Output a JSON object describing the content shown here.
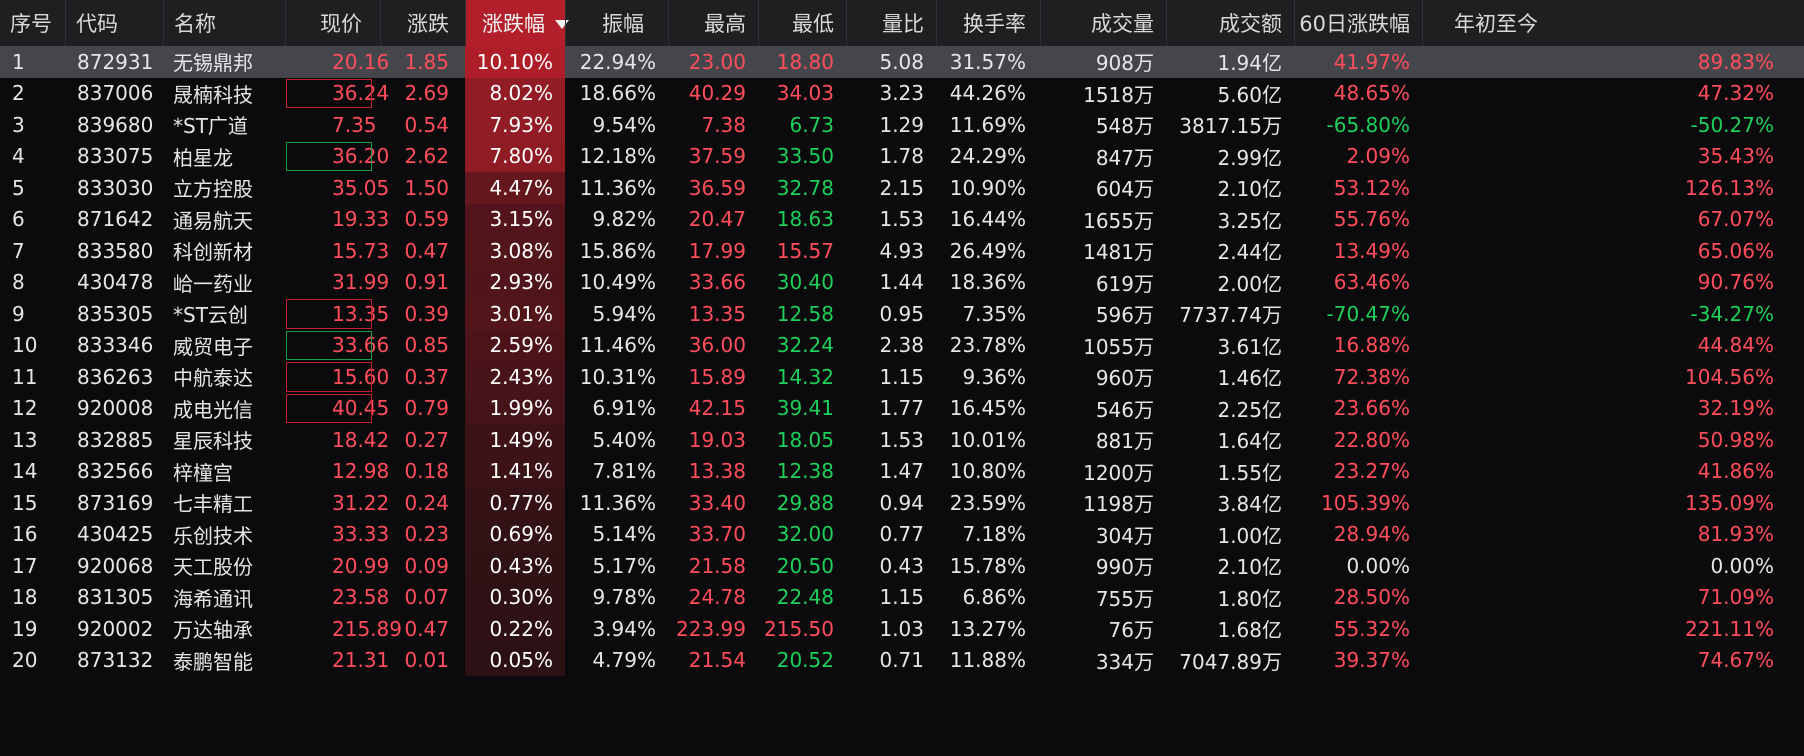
{
  "table": {
    "header": [
      "序号",
      "代码",
      "名称",
      "现价",
      "涨跌",
      "涨跌幅",
      "振幅",
      "最高",
      "最低",
      "量比",
      "换手率",
      "成交量",
      "成交额",
      "60日涨跌幅",
      "年初至今"
    ],
    "sort": {
      "column": "涨跌幅",
      "direction": "desc"
    },
    "rows": [
      {
        "idx": "1",
        "code": "872931",
        "name": "无锡鼎邦",
        "price": "20.16",
        "change": "1.85",
        "change_pct": "10.10%",
        "amplitude": "22.94%",
        "high": "23.00",
        "low": "18.80",
        "volume_ratio": "5.08",
        "turnover": "31.57%",
        "volume": "908万",
        "amount": "1.94亿",
        "change_60d": "41.97%",
        "ytd": "89.83%"
      },
      {
        "idx": "2",
        "code": "837006",
        "name": "晟楠科技",
        "price": "36.24",
        "change": "2.69",
        "change_pct": "8.02%",
        "amplitude": "18.66%",
        "high": "40.29",
        "low": "34.03",
        "volume_ratio": "3.23",
        "turnover": "44.26%",
        "volume": "1518万",
        "amount": "5.60亿",
        "change_60d": "48.65%",
        "ytd": "47.32%"
      },
      {
        "idx": "3",
        "code": "839680",
        "name": "*ST广道",
        "price": "7.35",
        "change": "0.54",
        "change_pct": "7.93%",
        "amplitude": "9.54%",
        "high": "7.38",
        "low": "6.73",
        "volume_ratio": "1.29",
        "turnover": "11.69%",
        "volume": "548万",
        "amount": "3817.15万",
        "change_60d": "-65.80%",
        "ytd": "-50.27%"
      },
      {
        "idx": "4",
        "code": "833075",
        "name": "柏星龙",
        "price": "36.20",
        "change": "2.62",
        "change_pct": "7.80%",
        "amplitude": "12.18%",
        "high": "37.59",
        "low": "33.50",
        "volume_ratio": "1.78",
        "turnover": "24.29%",
        "volume": "847万",
        "amount": "2.99亿",
        "change_60d": "2.09%",
        "ytd": "35.43%"
      },
      {
        "idx": "5",
        "code": "833030",
        "name": "立方控股",
        "price": "35.05",
        "change": "1.50",
        "change_pct": "4.47%",
        "amplitude": "11.36%",
        "high": "36.59",
        "low": "32.78",
        "volume_ratio": "2.15",
        "turnover": "10.90%",
        "volume": "604万",
        "amount": "2.10亿",
        "change_60d": "53.12%",
        "ytd": "126.13%"
      },
      {
        "idx": "6",
        "code": "871642",
        "name": "通易航天",
        "price": "19.33",
        "change": "0.59",
        "change_pct": "3.15%",
        "amplitude": "9.82%",
        "high": "20.47",
        "low": "18.63",
        "volume_ratio": "1.53",
        "turnover": "16.44%",
        "volume": "1655万",
        "amount": "3.25亿",
        "change_60d": "55.76%",
        "ytd": "67.07%"
      },
      {
        "idx": "7",
        "code": "833580",
        "name": "科创新材",
        "price": "15.73",
        "change": "0.47",
        "change_pct": "3.08%",
        "amplitude": "15.86%",
        "high": "17.99",
        "low": "15.57",
        "volume_ratio": "4.93",
        "turnover": "26.49%",
        "volume": "1481万",
        "amount": "2.44亿",
        "change_60d": "13.49%",
        "ytd": "65.06%"
      },
      {
        "idx": "8",
        "code": "430478",
        "name": "峆一药业",
        "price": "31.99",
        "change": "0.91",
        "change_pct": "2.93%",
        "amplitude": "10.49%",
        "high": "33.66",
        "low": "30.40",
        "volume_ratio": "1.44",
        "turnover": "18.36%",
        "volume": "619万",
        "amount": "2.00亿",
        "change_60d": "63.46%",
        "ytd": "90.76%"
      },
      {
        "idx": "9",
        "code": "835305",
        "name": "*ST云创",
        "price": "13.35",
        "change": "0.39",
        "change_pct": "3.01%",
        "amplitude": "5.94%",
        "high": "13.35",
        "low": "12.58",
        "volume_ratio": "0.95",
        "turnover": "7.35%",
        "volume": "596万",
        "amount": "7737.74万",
        "change_60d": "-70.47%",
        "ytd": "-34.27%"
      },
      {
        "idx": "10",
        "code": "833346",
        "name": "威贸电子",
        "price": "33.66",
        "change": "0.85",
        "change_pct": "2.59%",
        "amplitude": "11.46%",
        "high": "36.00",
        "low": "32.24",
        "volume_ratio": "2.38",
        "turnover": "23.78%",
        "volume": "1055万",
        "amount": "3.61亿",
        "change_60d": "16.88%",
        "ytd": "44.84%"
      },
      {
        "idx": "11",
        "code": "836263",
        "name": "中航泰达",
        "price": "15.60",
        "change": "0.37",
        "change_pct": "2.43%",
        "amplitude": "10.31%",
        "high": "15.89",
        "low": "14.32",
        "volume_ratio": "1.15",
        "turnover": "9.36%",
        "volume": "960万",
        "amount": "1.46亿",
        "change_60d": "72.38%",
        "ytd": "104.56%"
      },
      {
        "idx": "12",
        "code": "920008",
        "name": "成电光信",
        "price": "40.45",
        "change": "0.79",
        "change_pct": "1.99%",
        "amplitude": "6.91%",
        "high": "42.15",
        "low": "39.41",
        "volume_ratio": "1.77",
        "turnover": "16.45%",
        "volume": "546万",
        "amount": "2.25亿",
        "change_60d": "23.66%",
        "ytd": "32.19%"
      },
      {
        "idx": "13",
        "code": "832885",
        "name": "星辰科技",
        "price": "18.42",
        "change": "0.27",
        "change_pct": "1.49%",
        "amplitude": "5.40%",
        "high": "19.03",
        "low": "18.05",
        "volume_ratio": "1.53",
        "turnover": "10.01%",
        "volume": "881万",
        "amount": "1.64亿",
        "change_60d": "22.80%",
        "ytd": "50.98%"
      },
      {
        "idx": "14",
        "code": "832566",
        "name": "梓橦宫",
        "price": "12.98",
        "change": "0.18",
        "change_pct": "1.41%",
        "amplitude": "7.81%",
        "high": "13.38",
        "low": "12.38",
        "volume_ratio": "1.47",
        "turnover": "10.80%",
        "volume": "1200万",
        "amount": "1.55亿",
        "change_60d": "23.27%",
        "ytd": "41.86%"
      },
      {
        "idx": "15",
        "code": "873169",
        "name": "七丰精工",
        "price": "31.22",
        "change": "0.24",
        "change_pct": "0.77%",
        "amplitude": "11.36%",
        "high": "33.40",
        "low": "29.88",
        "volume_ratio": "0.94",
        "turnover": "23.59%",
        "volume": "1198万",
        "amount": "3.84亿",
        "change_60d": "105.39%",
        "ytd": "135.09%"
      },
      {
        "idx": "16",
        "code": "430425",
        "name": "乐创技术",
        "price": "33.33",
        "change": "0.23",
        "change_pct": "0.69%",
        "amplitude": "5.14%",
        "high": "33.70",
        "low": "32.00",
        "volume_ratio": "0.77",
        "turnover": "7.18%",
        "volume": "304万",
        "amount": "1.00亿",
        "change_60d": "28.94%",
        "ytd": "81.93%"
      },
      {
        "idx": "17",
        "code": "920068",
        "name": "天工股份",
        "price": "20.99",
        "change": "0.09",
        "change_pct": "0.43%",
        "amplitude": "5.17%",
        "high": "21.58",
        "low": "20.50",
        "volume_ratio": "0.43",
        "turnover": "15.78%",
        "volume": "990万",
        "amount": "2.10亿",
        "change_60d": "0.00%",
        "ytd": "0.00%"
      },
      {
        "idx": "18",
        "code": "831305",
        "name": "海希通讯",
        "price": "23.58",
        "change": "0.07",
        "change_pct": "0.30%",
        "amplitude": "9.78%",
        "high": "24.78",
        "low": "22.48",
        "volume_ratio": "1.15",
        "turnover": "6.86%",
        "volume": "755万",
        "amount": "1.80亿",
        "change_60d": "28.50%",
        "ytd": "71.09%"
      },
      {
        "idx": "19",
        "code": "920002",
        "name": "万达轴承",
        "price": "215.89",
        "change": "0.47",
        "change_pct": "0.22%",
        "amplitude": "3.94%",
        "high": "223.99",
        "low": "215.50",
        "volume_ratio": "1.03",
        "turnover": "13.27%",
        "volume": "76万",
        "amount": "1.68亿",
        "change_60d": "55.32%",
        "ytd": "221.11%"
      },
      {
        "idx": "20",
        "code": "873132",
        "name": "泰鹏智能",
        "price": "21.31",
        "change": "0.01",
        "change_pct": "0.05%",
        "amplitude": "4.79%",
        "high": "21.54",
        "low": "20.52",
        "volume_ratio": "0.71",
        "turnover": "11.88%",
        "volume": "334万",
        "amount": "7047.89万",
        "change_60d": "39.37%",
        "ytd": "74.67%"
      }
    ]
  },
  "colors": {
    "up": "#ff4d5b",
    "down": "#1ecf5a",
    "neutral": "#e6e6e6",
    "sort_header_bg": "#b21f2a",
    "pct_bg_strong": "#b21f2a",
    "pct_bg_weak": "#2a1114",
    "selected_row_bg": "#45464b",
    "price_box_red": "#c4202f",
    "price_box_green": "#1a9c44"
  },
  "selected_row_index": 0,
  "price_box_rows": {
    "1": "red",
    "3": "green",
    "8": "red",
    "9": "green",
    "10": "red",
    "11": "red"
  }
}
